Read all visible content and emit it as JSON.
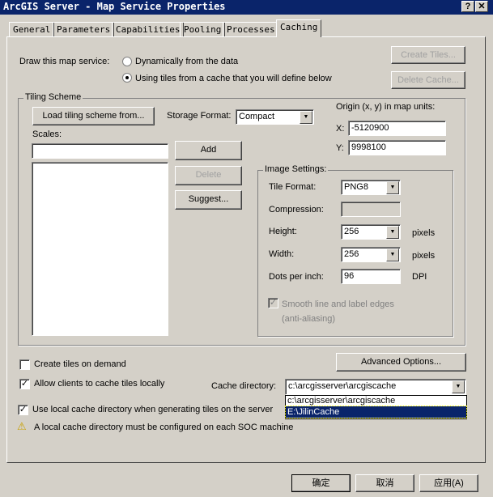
{
  "window": {
    "title": "ArcGIS Server - Map Service Properties",
    "help": "?",
    "close": "✕"
  },
  "tabs": [
    "General",
    "Parameters",
    "Capabilities",
    "Pooling",
    "Processes",
    "Caching"
  ],
  "draw": {
    "label": "Draw this map service:",
    "opt1": "Dynamically from the data",
    "opt2": "Using tiles from a cache that you will define below",
    "create_tiles": "Create Tiles...",
    "delete_cache": "Delete Cache..."
  },
  "tiling": {
    "title": "Tiling Scheme",
    "load": "Load tiling scheme from...",
    "storage_label": "Storage Format:",
    "storage": "Compact",
    "origin_label": "Origin (x, y) in map units:",
    "x_label": "X:",
    "x": "-5120900",
    "y_label": "Y:",
    "y": "9998100",
    "scales_label": "Scales:",
    "add": "Add",
    "delete": "Delete",
    "suggest": "Suggest..."
  },
  "image": {
    "title": "Image Settings:",
    "format_label": "Tile Format:",
    "format": "PNG8",
    "compression_label": "Compression:",
    "height_label": "Height:",
    "height": "256",
    "width_label": "Width:",
    "width": "256",
    "pixels": "pixels",
    "dpi_label": "Dots per inch:",
    "dpi": "96",
    "dpi_unit": "DPI",
    "smooth": "Smooth line and label edges",
    "smooth2": "(anti-aliasing)"
  },
  "options": {
    "on_demand": "Create tiles on demand",
    "allow_clients": "Allow clients to cache tiles locally",
    "advanced": "Advanced Options...",
    "cache_dir_label": "Cache directory:",
    "cache_dir": "c:\\arcgisserver\\arcgiscache",
    "cache_dir_options": [
      "c:\\arcgisserver\\arcgiscache",
      "E:\\JilinCache"
    ],
    "use_local": "Use local cache directory when generating tiles on the server",
    "warning": "A local cache directory must be configured on each SOC machine"
  },
  "footer": {
    "ok": "确定",
    "cancel": "取消",
    "apply": "应用(A)"
  }
}
